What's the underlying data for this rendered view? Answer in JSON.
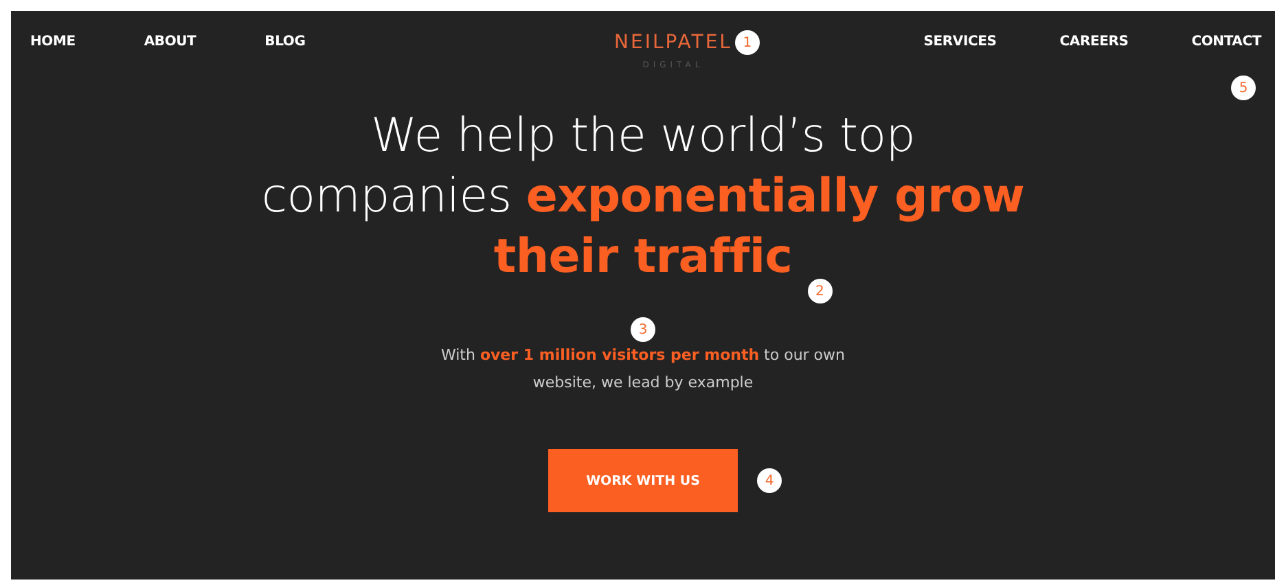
{
  "nav": {
    "left": [
      {
        "label": "HOME"
      },
      {
        "label": "ABOUT"
      },
      {
        "label": "BLOG"
      }
    ],
    "logo": {
      "name": "NEILPATEL",
      "tagline": "DIGITAL",
      "marker": "1"
    },
    "right": [
      {
        "label": "SERVICES"
      },
      {
        "label": "CAREERS"
      },
      {
        "label": "CONTACT"
      }
    ],
    "marker": "5"
  },
  "hero": {
    "headline_lines": [
      "We help the world’s top",
      "companies **exponentially grow**",
      "**their traffic**"
    ],
    "headline_marker": "2",
    "subtext": "With **over 1 million visitors per month** to our own website, we lead by example",
    "subtext_marker": "3",
    "button": {
      "label": "WORK WITH US",
      "marker": "4"
    }
  }
}
